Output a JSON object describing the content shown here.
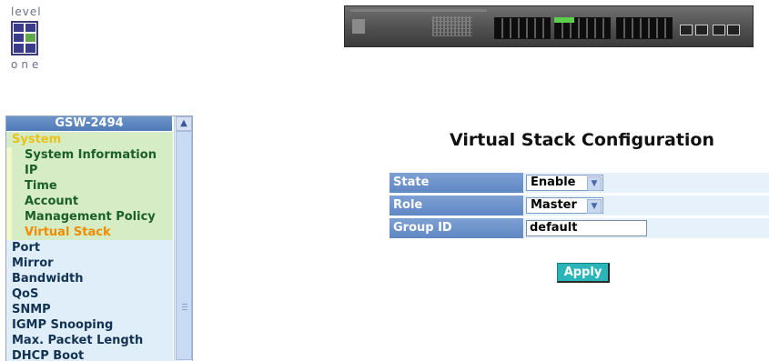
{
  "brand": {
    "top": "level",
    "bottom": "one"
  },
  "sidebar": {
    "title": "GSW-2494",
    "items": [
      {
        "label": "System",
        "kind": "sys"
      },
      {
        "label": "System Information",
        "kind": "sub"
      },
      {
        "label": "IP",
        "kind": "sub"
      },
      {
        "label": "Time",
        "kind": "sub"
      },
      {
        "label": "Account",
        "kind": "sub"
      },
      {
        "label": "Management Policy",
        "kind": "sub"
      },
      {
        "label": "Virtual Stack",
        "kind": "sub-active"
      },
      {
        "label": "Port",
        "kind": "top"
      },
      {
        "label": "Mirror",
        "kind": "top"
      },
      {
        "label": "Bandwidth",
        "kind": "top"
      },
      {
        "label": "QoS",
        "kind": "top"
      },
      {
        "label": "SNMP",
        "kind": "top"
      },
      {
        "label": "IGMP Snooping",
        "kind": "top"
      },
      {
        "label": "Max. Packet Length",
        "kind": "top"
      },
      {
        "label": "DHCP Boot",
        "kind": "top"
      }
    ]
  },
  "main": {
    "title": "Virtual Stack Configuration",
    "fields": {
      "state": {
        "label": "State",
        "value": "Enable"
      },
      "role": {
        "label": "Role",
        "value": "Master"
      },
      "group_id": {
        "label": "Group ID",
        "value": "default"
      }
    },
    "apply_label": "Apply"
  },
  "colors": {
    "header_blue": "#5f87c4",
    "field_bg": "#e6f1fb",
    "active_menu": "#f08c00",
    "apply_button": "#2bb5b9"
  }
}
